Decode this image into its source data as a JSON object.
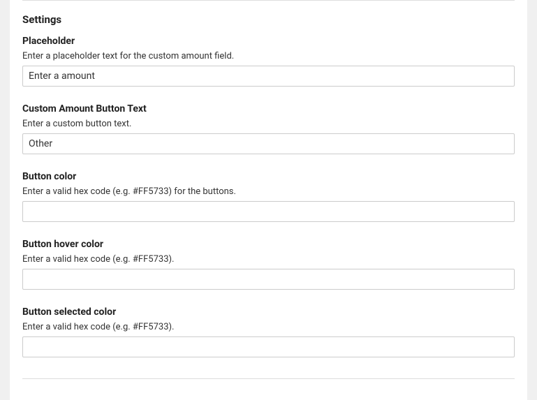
{
  "settings": {
    "heading": "Settings",
    "placeholder": {
      "label": "Placeholder",
      "description": "Enter a placeholder text for the custom amount field.",
      "value": "Enter a amount"
    },
    "custom_amount_button_text": {
      "label": "Custom Amount Button Text",
      "description": "Enter a custom button text.",
      "value": "Other"
    },
    "button_color": {
      "label": "Button color",
      "description": "Enter a valid hex code (e.g. #FF5733) for the buttons.",
      "value": ""
    },
    "button_hover_color": {
      "label": "Button hover color",
      "description": "Enter a valid hex code (e.g. #FF5733).",
      "value": ""
    },
    "button_selected_color": {
      "label": "Button selected color",
      "description": "Enter a valid hex code (e.g. #FF5733).",
      "value": ""
    }
  }
}
